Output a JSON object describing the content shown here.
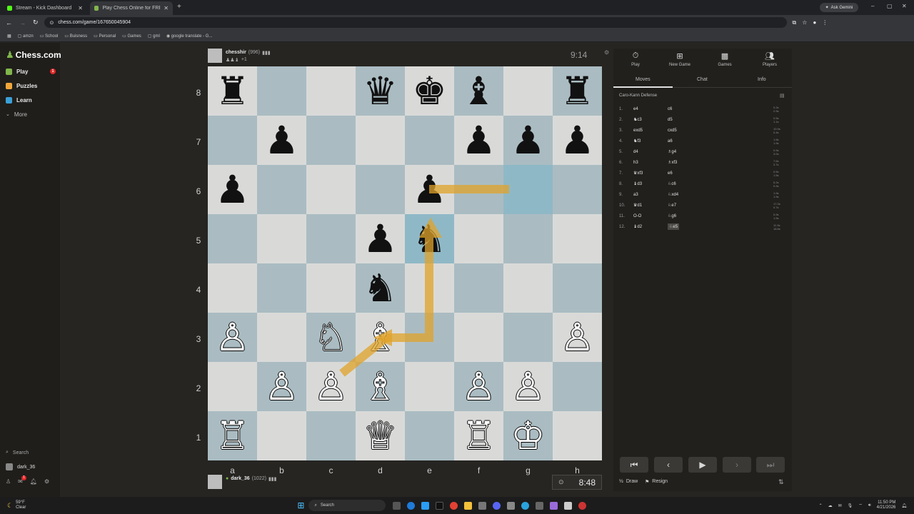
{
  "browser": {
    "tabs": [
      {
        "title": "Stream - Kick Dashboard",
        "active": false
      },
      {
        "title": "Play Chess Online for FREE - 2 ...",
        "active": true
      }
    ],
    "ask_gemini": "Ask Gemini",
    "url": "chess.com/game/167650045904",
    "bookmarks": [
      "amzn",
      "School",
      "Buisness",
      "Personal",
      "Games",
      "gml",
      "google translate - G..."
    ]
  },
  "sidebar": {
    "logo": "Chess.com",
    "items": [
      {
        "label": "Play",
        "icon": "play-icon",
        "color": "#81b64c"
      },
      {
        "label": "Puzzles",
        "icon": "puzzle-icon",
        "color": "#f0a73a"
      },
      {
        "label": "Learn",
        "icon": "learn-icon",
        "color": "#3aa1d8"
      },
      {
        "label": "More",
        "icon": "chevron-down-icon",
        "color": "#aaaaaa"
      }
    ],
    "play_badge": "1",
    "search": "Search",
    "user": "dark_36",
    "mail_badge": "1"
  },
  "opponent": {
    "name": "chesshir",
    "rating": "(996)",
    "extra": "+1",
    "clock": "9:14"
  },
  "player": {
    "name": "dark_36",
    "rating": "(1022)",
    "clock": "8:48"
  },
  "board": {
    "ranks": [
      "8",
      "7",
      "6",
      "5",
      "4",
      "3",
      "2",
      "1"
    ],
    "files": [
      "a",
      "b",
      "c",
      "d",
      "e",
      "f",
      "g",
      "h"
    ],
    "pieces": [
      [
        "♜",
        "",
        "",
        "♛",
        "♚",
        "♝",
        "",
        "♜"
      ],
      [
        "",
        "♟",
        "",
        "",
        "",
        "♟",
        "♟",
        "♟"
      ],
      [
        "♟",
        "",
        "",
        "",
        "♟",
        "",
        "",
        ""
      ],
      [
        "",
        "",
        "",
        "♟",
        "♞",
        "",
        "",
        ""
      ],
      [
        "",
        "",
        "",
        "♞",
        "",
        "",
        "",
        ""
      ],
      [
        "♙",
        "",
        "♘",
        "♗",
        "",
        "",
        "",
        "♙"
      ],
      [
        "",
        "♙",
        "♙",
        "♗",
        "",
        "♙",
        "♙",
        ""
      ],
      [
        "♖",
        "",
        "",
        "♕",
        "",
        "♖",
        "♔",
        ""
      ]
    ],
    "piece_colors": [
      [
        "b",
        "",
        "",
        "b",
        "b",
        "b",
        "",
        "b"
      ],
      [
        "",
        "b",
        "",
        "",
        "",
        "b",
        "b",
        "b"
      ],
      [
        "b",
        "",
        "",
        "",
        "b",
        "",
        "",
        ""
      ],
      [
        "",
        "",
        "",
        "b",
        "b",
        "",
        "",
        ""
      ],
      [
        "",
        "",
        "",
        "b",
        "",
        "",
        "",
        ""
      ],
      [
        "w",
        "",
        "w",
        "w",
        "",
        "",
        "",
        "w"
      ],
      [
        "",
        "w",
        "w",
        "w",
        "",
        "w",
        "w",
        ""
      ],
      [
        "w",
        "",
        "",
        "w",
        "",
        "w",
        "w",
        ""
      ]
    ]
  },
  "panel": {
    "tabs": [
      {
        "label": "Play",
        "icon": "stopwatch-icon"
      },
      {
        "label": "New Game",
        "icon": "plus-icon"
      },
      {
        "label": "Games",
        "icon": "games-icon"
      },
      {
        "label": "Players",
        "icon": "players-icon"
      }
    ],
    "subtabs": [
      "Moves",
      "Chat",
      "Info"
    ],
    "opening": "Caro-Kann Defense",
    "moves": [
      {
        "n": "1.",
        "w": "e4",
        "b": "c6",
        "t": "0.2s 2.9s"
      },
      {
        "n": "2.",
        "w": "♞c3",
        "b": "d5",
        "t": "0.5s 1.1s"
      },
      {
        "n": "3.",
        "w": "exd5",
        "b": "cxd5",
        "t": "10.9s 0.4s"
      },
      {
        "n": "4.",
        "w": "♞f3",
        "b": "a6",
        "t": "1.5s 1.9s"
      },
      {
        "n": "5.",
        "w": "d4",
        "b": "♗g4",
        "t": "0.9s 3.0s"
      },
      {
        "n": "6.",
        "w": "h3",
        "b": "♗xf3",
        "t": "7.6s 3.7s"
      },
      {
        "n": "7.",
        "w": "♛xf3",
        "b": "e6",
        "t": "0.5s 1.5s"
      },
      {
        "n": "8.",
        "w": "♝d3",
        "b": "♘c6",
        "t": "5.2s 0.9s"
      },
      {
        "n": "9.",
        "w": "a3",
        "b": "♘xd4",
        "t": "1.9s 1.9s"
      },
      {
        "n": "10.",
        "w": "♛d1",
        "b": "♘e7",
        "t": "17.3s 0.7s"
      },
      {
        "n": "11.",
        "w": "O-O",
        "b": "♘g6",
        "t": "0.9s 1.5s"
      },
      {
        "n": "12.",
        "w": "♝d2",
        "b": "♘e5",
        "t": "11.3s 18.8s"
      }
    ],
    "draw": "Draw",
    "resign": "Resign"
  },
  "taskbar": {
    "weather_temp": "59°F",
    "weather_desc": "Clear",
    "search": "Search",
    "time": "11:50 PM",
    "date": "4/21/2026"
  }
}
